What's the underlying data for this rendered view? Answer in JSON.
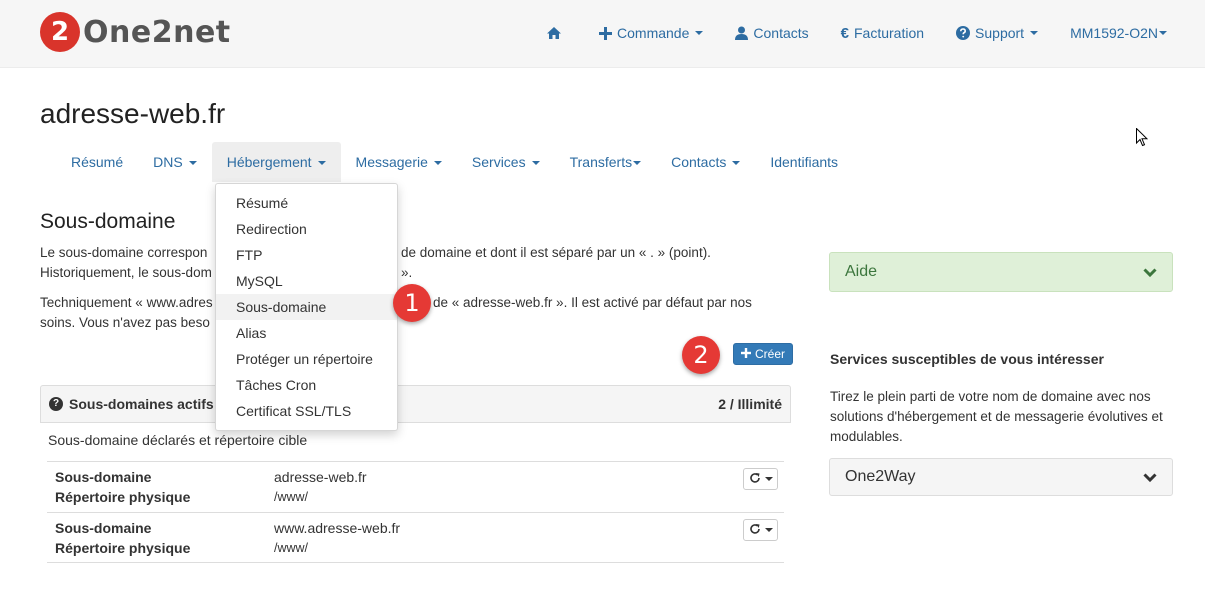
{
  "brand": {
    "name": "One2net",
    "mark": "2"
  },
  "topnav": {
    "home_icon": "home-icon",
    "items": [
      {
        "label": "Commande",
        "icon": "plus-icon"
      },
      {
        "label": "Contacts",
        "icon": "user-icon"
      },
      {
        "label": "Facturation",
        "icon": "euro-icon",
        "glyph": "€"
      },
      {
        "label": "Support",
        "icon": "question-circle-icon"
      },
      {
        "label": "MM1592-O2N"
      }
    ]
  },
  "page": {
    "title": "adresse-web.fr"
  },
  "subnav": {
    "tabs": [
      {
        "label": "Résumé"
      },
      {
        "label": "DNS"
      },
      {
        "label": "Hébergement",
        "active": true
      },
      {
        "label": "Messagerie"
      },
      {
        "label": "Services"
      },
      {
        "label": "Transferts"
      },
      {
        "label": "Contacts"
      },
      {
        "label": "Identifiants"
      }
    ]
  },
  "dropdown": {
    "items": [
      "Résumé",
      "Redirection",
      "FTP",
      "MySQL",
      "Sous-domaine",
      "Alias",
      "Protéger un répertoire",
      "Tâches Cron",
      "Certificat SSL/TLS"
    ]
  },
  "badges": {
    "one": "1",
    "two": "2"
  },
  "main": {
    "section_title": "Sous-domaine",
    "para1_line1_a": "Le sous-domaine correspon",
    "para1_line1_b": "m de domaine et dont il est séparé par un « . » (point).",
    "para1_line2_a": "Historiquement, le sous-dom",
    "para1_line2_b": "».",
    "para2_line1_a": "Techniquement « www.adres",
    "para2_line1_b": "de « adresse-web.fr ». Il est activé par défaut par nos",
    "para2_line2_a": "soins. Vous n'avez pas beso",
    "create_label": "Créer"
  },
  "table": {
    "title": "Sous-domaines actifs",
    "count": "2 / Illimité",
    "description": "Sous-domaine déclarés et répertoire cible",
    "label_sub": "Sous-domaine",
    "label_dir": "Répertoire physique",
    "rows": [
      {
        "subdomain": "adresse-web.fr",
        "directory": "/www/"
      },
      {
        "subdomain": "www.adresse-web.fr",
        "directory": "/www/"
      }
    ]
  },
  "sidebar": {
    "help_label": "Aide",
    "services_title": "Services susceptibles de vous intéresser",
    "services_text": "Tirez le plein parti de votre nom de domaine avec nos solutions d'hébergement et de messagerie évolutives et modulables.",
    "one2way_label": "One2Way"
  },
  "colors": {
    "accent": "#2d6ca2",
    "brand_red": "#d9342b",
    "badge_red": "#e53935",
    "help_green": "#dff0d8"
  }
}
